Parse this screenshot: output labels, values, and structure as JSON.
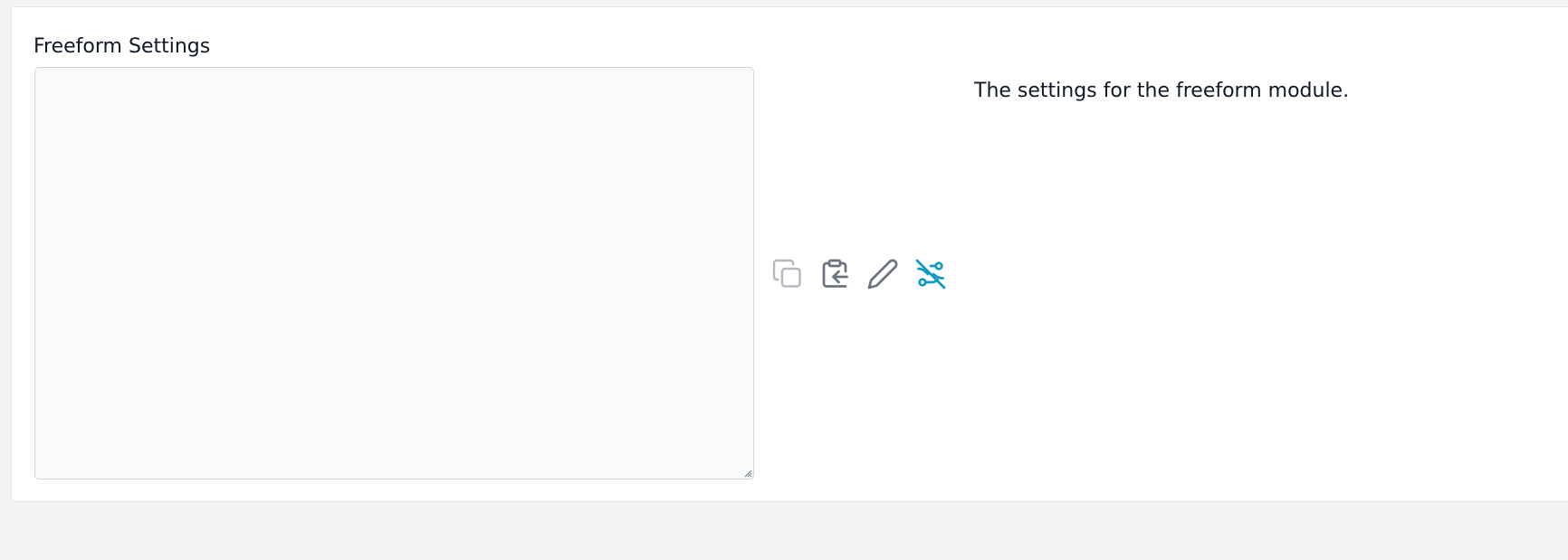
{
  "field": {
    "label": "Freeform Settings",
    "value": "",
    "placeholder": "",
    "description": "The settings for the freeform module."
  },
  "actions": {
    "copy_icon": "copy-icon",
    "paste_icon": "clipboard-paste-icon",
    "edit_icon": "pencil-icon",
    "variables_icon": "variables-off-icon"
  },
  "colors": {
    "icon_disabled": "#b4b8bf",
    "icon_default": "#6b7280",
    "icon_active": "#0e9ac0",
    "textarea_bg": "#f9fafb"
  }
}
